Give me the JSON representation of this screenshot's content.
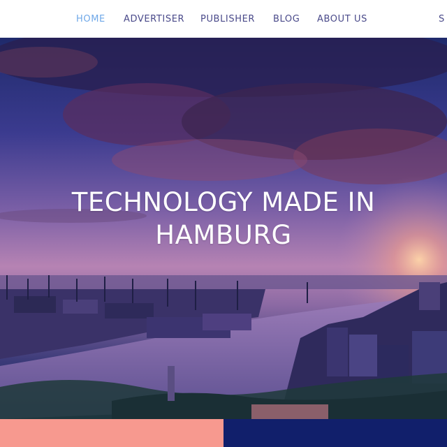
{
  "nav": {
    "items": [
      {
        "label": "HOME",
        "active": true
      },
      {
        "label": "ADVERTISER",
        "active": false
      },
      {
        "label": "PUBLISHER",
        "active": false
      },
      {
        "label": "BLOG",
        "active": false
      },
      {
        "label": "ABOUT US",
        "active": false
      }
    ],
    "partial_right": "S"
  },
  "hero": {
    "title_line1": "TECHNOLOGY MADE IN",
    "title_line2": "HAMBURG"
  },
  "colors": {
    "nav_active": "#6fa8e8",
    "nav_text": "#4a4a8a",
    "salmon_block": "#f7998f",
    "navy_block": "#111f6b"
  }
}
